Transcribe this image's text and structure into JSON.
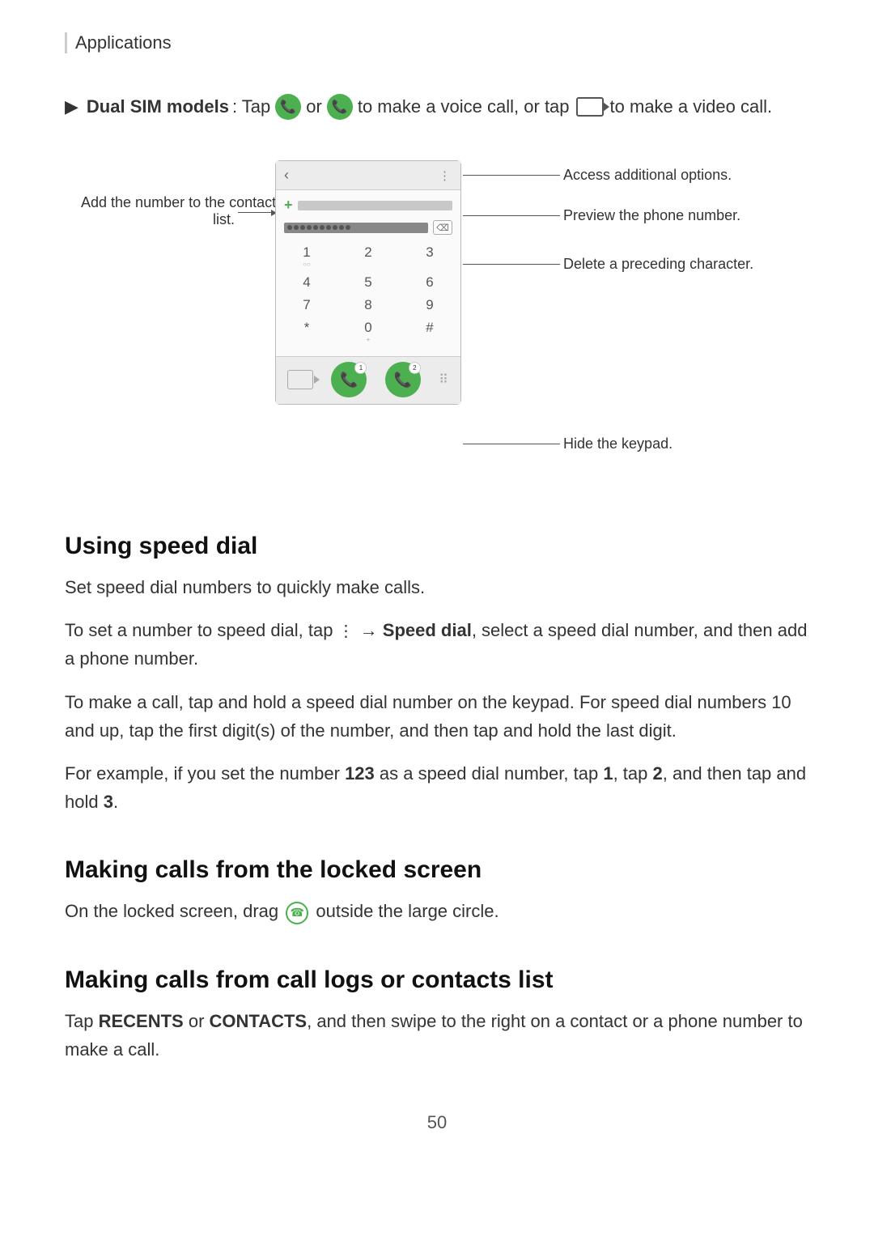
{
  "page": {
    "top_label": "Applications",
    "page_number": "50"
  },
  "dual_sim": {
    "prefix": "▶",
    "bold_text": "Dual SIM models",
    "text1": ": Tap",
    "text2": "or",
    "text3": "to make a voice call, or tap",
    "text4": "to make a video call."
  },
  "annotations": {
    "left_label": "Add the number to the contacts list.",
    "right": [
      {
        "id": "a1",
        "text": "Access additional options."
      },
      {
        "id": "a2",
        "text": "Preview the phone number."
      },
      {
        "id": "a3",
        "text": "Delete a preceding character."
      },
      {
        "id": "a4",
        "text": "Hide the keypad."
      }
    ]
  },
  "sections": [
    {
      "id": "speed-dial",
      "title": "Using speed dial",
      "paragraphs": [
        "Set speed dial numbers to quickly make calls.",
        "To set a number to speed dial, tap  → Speed dial, select a speed dial number, and then add a phone number.",
        "To make a call, tap and hold a speed dial number on the keypad. For speed dial numbers 10 and up, tap the first digit(s) of the number, and then tap and hold the last digit.",
        "For example, if you set the number 123 as a speed dial number, tap 1, tap 2, and then tap and hold 3."
      ]
    },
    {
      "id": "locked-screen",
      "title": "Making calls from the locked screen",
      "paragraphs": [
        "On the locked screen, drag  outside the large circle."
      ]
    },
    {
      "id": "call-logs",
      "title": "Making calls from call logs or contacts list",
      "paragraphs": [
        "Tap RECENTS or CONTACTS, and then swipe to the right on a contact or a phone number to make a call."
      ]
    }
  ]
}
